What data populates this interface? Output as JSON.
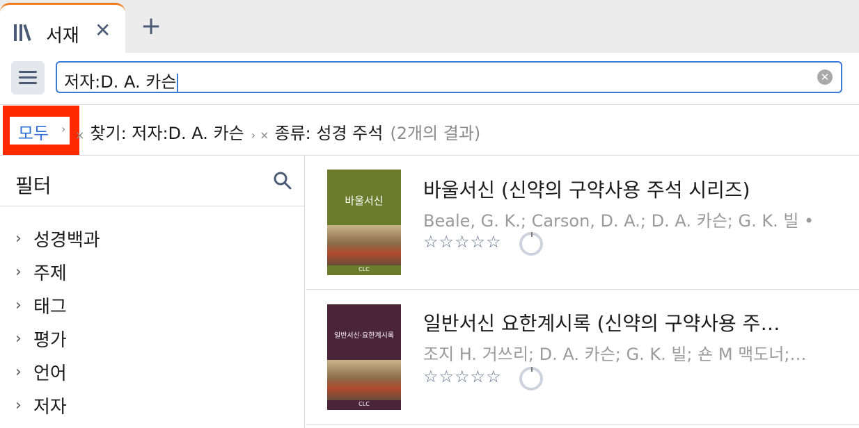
{
  "tab": {
    "icon": "library-icon",
    "title": "서재",
    "close": "✕",
    "add": "+"
  },
  "search": {
    "value": "저자:D. A. 카슨",
    "clear": "✕"
  },
  "breadcrumb": {
    "all": "모두",
    "find": "찾기: 저자:D. A. 카슨",
    "type": "종류: 성경 주석",
    "count": "(2개의 결과)",
    "remove": "×",
    "sep": "›"
  },
  "filters": {
    "title": "필터",
    "items": [
      {
        "label": "성경백과"
      },
      {
        "label": "주제"
      },
      {
        "label": "태그"
      },
      {
        "label": "평가"
      },
      {
        "label": "언어"
      },
      {
        "label": "저자"
      }
    ]
  },
  "results": [
    {
      "title": "바울서신 (신약의 구약사용 주석 시리즈)",
      "authors": "Beale, G. K.; Carson, D. A.; D. A. 카슨; G. K. 빌 •…",
      "stars": "☆☆☆☆☆",
      "cover_title": "바울서신",
      "cover_color": "#6b7c2c",
      "cover_publisher": "CLC"
    },
    {
      "title": "일반서신 요한계시록 (신약의 구약사용 주…",
      "authors": "조지 H. 거쓰리; D. A. 카슨; G. K. 빌; 숀 M 맥도너;…",
      "stars": "☆☆☆☆☆",
      "cover_title": "일반서신·요한계시록",
      "cover_color": "#4a2438",
      "cover_publisher": "CLC"
    }
  ],
  "colors": {
    "accent": "#3b7ad8",
    "highlight": "#ff2a00",
    "tab_accent": "#f07c1e"
  }
}
